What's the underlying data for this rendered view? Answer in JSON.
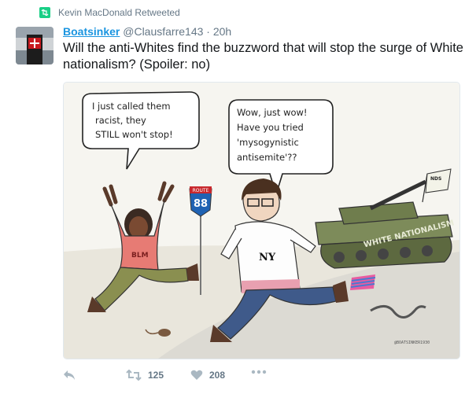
{
  "retweet": {
    "text": "Kevin MacDonald Retweeted"
  },
  "tweet": {
    "name": "Boatsinker",
    "handle": "@Clausfarre143",
    "separator": "·",
    "time": "20h",
    "text": "Will the anti-Whites find the buzzword that will stop the surge of White nationalism? (Spoiler: no)"
  },
  "cartoon": {
    "bubble1": [
      "I just called them",
      "racist, they",
      "STILL won't stop!"
    ],
    "bubble2": [
      "Wow, just wow!",
      "Have you tried",
      "'mysogynistic",
      "antisemite'??"
    ],
    "route_sign_top": "ROUTE",
    "route_sign_number": "88",
    "shirt_left": "BLM",
    "shirt_right": "NY",
    "tank_text": "WHITE NATIONALISM",
    "flag_text": "NDS",
    "signature": "@BOATSINKER1930"
  },
  "actions": {
    "reply_icon": "reply-icon",
    "retweet_icon": "retweet-icon",
    "retweet_count": "125",
    "like_icon": "heart-icon",
    "like_count": "208",
    "more_icon": "more-icon"
  },
  "colors": {
    "link": "#1b95e0",
    "muted": "#657786",
    "retweet_green": "#19cf86"
  }
}
